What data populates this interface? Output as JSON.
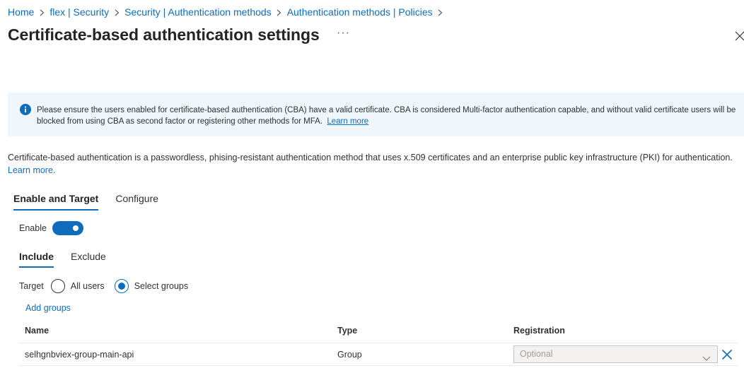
{
  "breadcrumb": {
    "items": [
      "Home",
      "flex | Security",
      "Security | Authentication methods",
      "Authentication methods | Policies"
    ]
  },
  "header": {
    "title": "Certificate-based authentication settings",
    "more": "···"
  },
  "banner": {
    "text": "Please ensure the users enabled for certificate-based authentication (CBA) have a valid certificate. CBA is considered Multi-factor authentication capable, and without valid certificate users will be blocked from using CBA as second factor or registering other methods for MFA.",
    "link": "Learn more",
    "icon": "info-icon"
  },
  "description": {
    "text": "Certificate-based authentication is a passwordless, phising-resistant authentication method that uses x.509 certificates and an enterprise public key infrastructure (PKI) for authentication.",
    "link": "Learn more."
  },
  "tabs": [
    {
      "label": "Enable and Target",
      "active": true
    },
    {
      "label": "Configure",
      "active": false
    }
  ],
  "enable": {
    "label": "Enable",
    "on": true
  },
  "subtabs": [
    {
      "label": "Include",
      "active": true
    },
    {
      "label": "Exclude",
      "active": false
    }
  ],
  "target": {
    "label": "Target",
    "options": [
      {
        "label": "All users",
        "checked": false
      },
      {
        "label": "Select groups",
        "checked": true
      }
    ]
  },
  "add_groups": "Add groups",
  "table": {
    "headers": {
      "name": "Name",
      "type": "Type",
      "registration": "Registration"
    },
    "rows": [
      {
        "name": "selhgnbviex-group-main-api",
        "type": "Group",
        "registration": "Optional"
      }
    ]
  },
  "colors": {
    "accent": "#0f6cbd",
    "banner_bg": "#eff6fc"
  }
}
